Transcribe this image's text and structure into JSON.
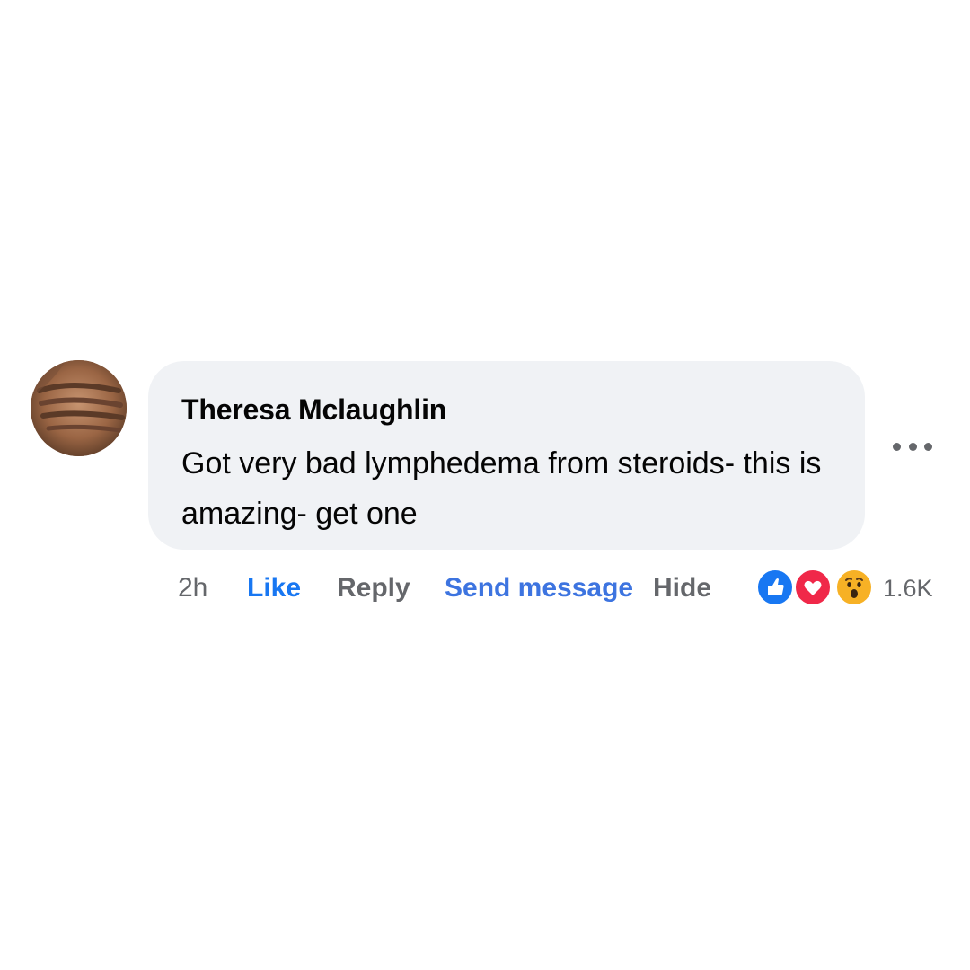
{
  "comment": {
    "author": "Theresa Mclaughlin",
    "text": "Got very bad lymphedema from steroids- this is amazing- get one",
    "avatar_icon": "profile-photo",
    "more_icon": "more-options-icon"
  },
  "actions": {
    "timestamp": "2h",
    "like": "Like",
    "reply": "Reply",
    "send_message": "Send message",
    "hide": "Hide"
  },
  "reactions": {
    "types": [
      "like",
      "love",
      "wow"
    ],
    "count": "1.6K"
  },
  "colors": {
    "bubble": "#f0f2f5",
    "like_blue": "#1877f2",
    "send_blue": "#3d74e0",
    "muted": "#65676b",
    "love_red": "#f02849",
    "wow_yellow": "#f7b125"
  }
}
